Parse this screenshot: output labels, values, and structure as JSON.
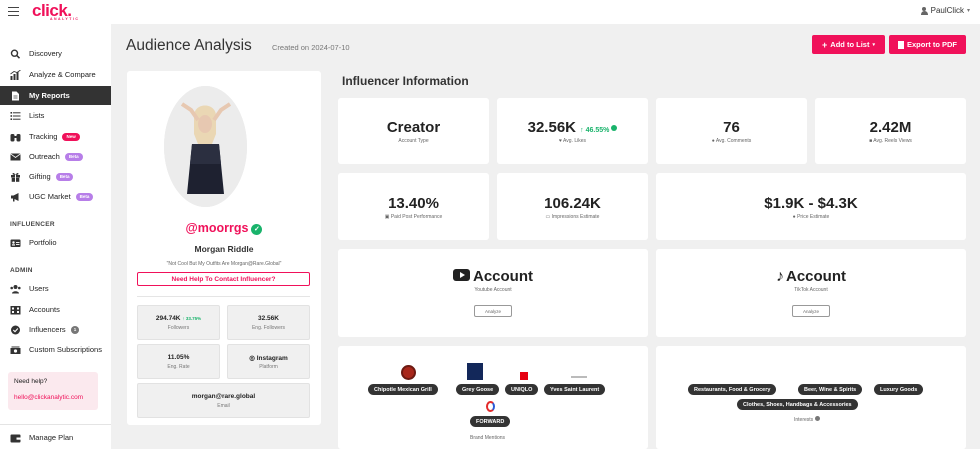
{
  "topbar": {
    "logo": "click.",
    "logo_sub": "ANALYTIC",
    "user": "PaulClick",
    "caret": "▾"
  },
  "sidebar": {
    "items": [
      {
        "label": "Discovery",
        "icon": "search-icon"
      },
      {
        "label": "Analyze & Compare",
        "icon": "chart-icon"
      },
      {
        "label": "My Reports",
        "icon": "file-icon"
      },
      {
        "label": "Lists",
        "icon": "list-icon"
      },
      {
        "label": "Tracking",
        "icon": "binoculars-icon",
        "badge": "New"
      },
      {
        "label": "Outreach",
        "icon": "envelope-icon",
        "badge": "Beta"
      },
      {
        "label": "Gifting",
        "icon": "gift-icon",
        "badge": "Beta"
      },
      {
        "label": "UGC Market",
        "icon": "megaphone-icon",
        "badge": "Beta"
      }
    ],
    "influencer_title": "INFLUENCER",
    "influencer_items": [
      {
        "label": "Portfolio",
        "icon": "id-card-icon"
      }
    ],
    "admin_title": "ADMIN",
    "admin_items": [
      {
        "label": "Users",
        "icon": "users-icon"
      },
      {
        "label": "Accounts",
        "icon": "building-icon"
      },
      {
        "label": "Influencers",
        "icon": "badge-check-icon",
        "badge": "1"
      },
      {
        "label": "Custom Subscriptions",
        "icon": "money-icon"
      }
    ],
    "help_title": "Need help?",
    "help_email": "hello@clickanalytic.com",
    "manage_plan": "Manage Plan"
  },
  "header": {
    "title": "Audience Analysis",
    "created": "Created on 2024-07-10",
    "add_to_list": "Add to List",
    "export_pdf": "Export to PDF",
    "add_caret": "▾"
  },
  "profile": {
    "handle": "@moorrgs",
    "name": "Morgan Riddle",
    "bio": "\"Not Cool But My Outfits Are Morgan@Rare.Global\"",
    "contact_button": "Need Help To Contact Influencer?",
    "followers_value": "294.74K",
    "followers_change": "↑ 33.75%",
    "followers_label": "Followers",
    "eng_followers_value": "32.56K",
    "eng_followers_label": "Eng. Followers",
    "eng_rate_value": "11.05%",
    "eng_rate_label": "Eng. Rate",
    "platform_value": "Instagram",
    "platform_label": "Platform",
    "email_value": "morgan@rare.global",
    "email_label": "Email"
  },
  "info": {
    "section_title": "Influencer Information",
    "account_type_value": "Creator",
    "account_type_label": "Account Type",
    "avg_likes_value": "32.56K",
    "avg_likes_change": "↑ 46.55%",
    "avg_likes_label": "Avg. Likes",
    "avg_comments_value": "76",
    "avg_comments_label": "Avg. Comments",
    "avg_reels_value": "2.42M",
    "avg_reels_label": "Avg. Reels Views",
    "paid_post_value": "13.40%",
    "paid_post_label": "Paid Post Performance",
    "impressions_value": "106.24K",
    "impressions_label": "Impressions Estimate",
    "price_value": "$1.9K - $4.3K",
    "price_label": "Price Estimate"
  },
  "accounts": {
    "youtube_title": "Account",
    "youtube_sub": "Youtube Account",
    "tiktok_title": "Account",
    "tiktok_sub": "TikTok Account",
    "analyze": "Analyze"
  },
  "brands": {
    "items": [
      "Chipotle Mexican Grill",
      "Grey Goose",
      "UNIQLO",
      "Yves Saint Laurent",
      "FORWARD"
    ],
    "label": "Brand Mentions"
  },
  "interests": {
    "items": [
      "Restaurants, Food & Grocery",
      "Beer, Wine & Spirits",
      "Luxury Goods",
      "Clothes, Shoes, Handbags & Accessories"
    ],
    "label": "Interests"
  },
  "colors": {
    "brand": "#f0115a",
    "success": "#19b36b",
    "nav_active": "#333333",
    "beta": "#b77ee8"
  }
}
